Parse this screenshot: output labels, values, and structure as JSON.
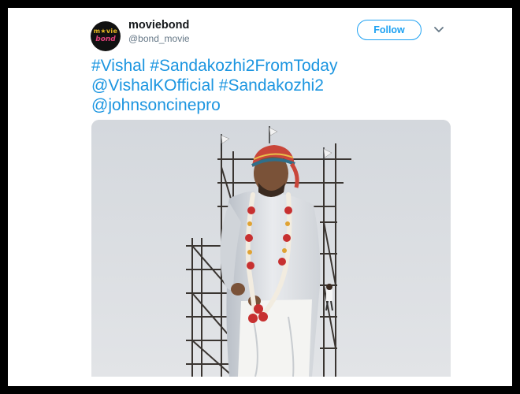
{
  "tweet": {
    "author": {
      "display_name": "moviebond",
      "handle": "@bond_movie",
      "avatar_top": "m★vie",
      "avatar_bottom": "bond"
    },
    "follow_label": "Follow",
    "text_parts": [
      "#Vishal",
      "#Sandakozhi2FromToday",
      "@VishalKOfficial",
      "#Sandakozhi2",
      "@johnsoncinepro"
    ],
    "media_icon": "photo-image"
  },
  "colors": {
    "link": "#1b95e0",
    "follow": "#1da1f2",
    "name": "#14171a",
    "handle": "#657786",
    "frame": "#000000"
  }
}
